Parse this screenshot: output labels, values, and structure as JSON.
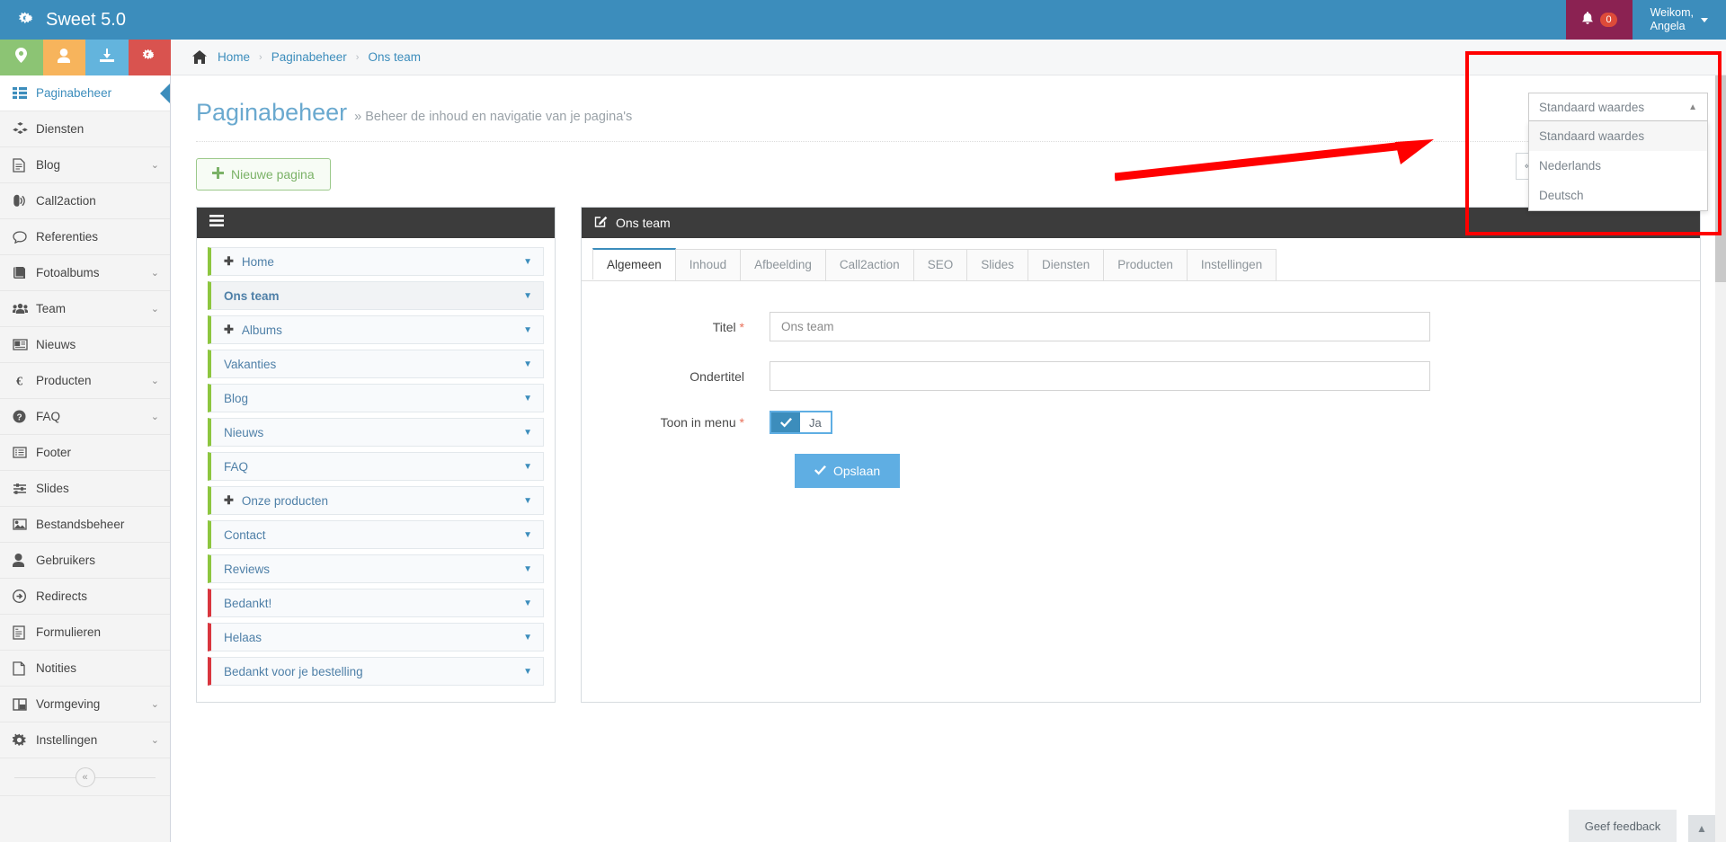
{
  "topbar": {
    "brand": "Sweet 5.0",
    "brand_icon": "gears-icon",
    "notification_count": "0",
    "user_greeting": "Weikom,",
    "user_name": "Angela"
  },
  "quick_actions": [
    {
      "name": "location-icon",
      "color": "#8cc474"
    },
    {
      "name": "user-icon",
      "color": "#f7b45c"
    },
    {
      "name": "download-icon",
      "color": "#63b4dd"
    },
    {
      "name": "gears-icon",
      "color": "#d9534f"
    }
  ],
  "breadcrumb": {
    "home_icon": "home-icon",
    "items": [
      "Home",
      "Paginabeheer",
      "Ons team"
    ]
  },
  "sidebar": {
    "items": [
      {
        "label": "Paginabeheer",
        "icon": "list-icon",
        "active": true,
        "caret": false
      },
      {
        "label": "Diensten",
        "icon": "cubes-icon",
        "active": false,
        "caret": false
      },
      {
        "label": "Blog",
        "icon": "document-icon",
        "active": false,
        "caret": true
      },
      {
        "label": "Call2action",
        "icon": "bullhorn-icon",
        "active": false,
        "caret": false
      },
      {
        "label": "Referenties",
        "icon": "comment-icon",
        "active": false,
        "caret": false
      },
      {
        "label": "Fotoalbums",
        "icon": "book-icon",
        "active": false,
        "caret": true
      },
      {
        "label": "Team",
        "icon": "users-icon",
        "active": false,
        "caret": true
      },
      {
        "label": "Nieuws",
        "icon": "newspaper-icon",
        "active": false,
        "caret": false
      },
      {
        "label": "Producten",
        "icon": "euro-icon",
        "active": false,
        "caret": true
      },
      {
        "label": "FAQ",
        "icon": "question-circle-icon",
        "active": false,
        "caret": true
      },
      {
        "label": "Footer",
        "icon": "list-alt-icon",
        "active": false,
        "caret": false
      },
      {
        "label": "Slides",
        "icon": "sliders-icon",
        "active": false,
        "caret": false
      },
      {
        "label": "Bestandsbeheer",
        "icon": "image-icon",
        "active": false,
        "caret": false
      },
      {
        "label": "Gebruikers",
        "icon": "user-icon",
        "active": false,
        "caret": false
      },
      {
        "label": "Redirects",
        "icon": "arrow-circle-right-icon",
        "active": false,
        "caret": false
      },
      {
        "label": "Formulieren",
        "icon": "form-icon",
        "active": false,
        "caret": false
      },
      {
        "label": "Notities",
        "icon": "note-icon",
        "active": false,
        "caret": false
      },
      {
        "label": "Vormgeving",
        "icon": "layout-icon",
        "active": false,
        "caret": true
      },
      {
        "label": "Instellingen",
        "icon": "gear-icon",
        "active": false,
        "caret": true
      }
    ],
    "collapse_icon": "double-chevron-left-icon"
  },
  "page": {
    "title": "Paginabeheer",
    "subtitle": "» Beheer de inhoud en navigatie van je pagina's",
    "new_page_button": "Nieuwe pagina",
    "new_page_icon": "plus-icon"
  },
  "tree": {
    "menu_icon": "hamburger-icon",
    "items": [
      {
        "label": "Home",
        "expandable": true,
        "accent": "#8dc63f",
        "selected": false
      },
      {
        "label": "Ons team",
        "expandable": false,
        "accent": "#8dc63f",
        "selected": true
      },
      {
        "label": "Albums",
        "expandable": true,
        "accent": "#8dc63f",
        "selected": false
      },
      {
        "label": "Vakanties",
        "expandable": false,
        "accent": "#8dc63f",
        "selected": false
      },
      {
        "label": "Blog",
        "expandable": false,
        "accent": "#8dc63f",
        "selected": false
      },
      {
        "label": "Nieuws",
        "expandable": false,
        "accent": "#8dc63f",
        "selected": false
      },
      {
        "label": "FAQ",
        "expandable": false,
        "accent": "#8dc63f",
        "selected": false
      },
      {
        "label": "Onze producten",
        "expandable": true,
        "accent": "#8dc63f",
        "selected": false
      },
      {
        "label": "Contact",
        "expandable": false,
        "accent": "#8dc63f",
        "selected": false
      },
      {
        "label": "Reviews",
        "expandable": false,
        "accent": "#8dc63f",
        "selected": false
      },
      {
        "label": "Bedankt!",
        "expandable": false,
        "accent": "#d9363e",
        "selected": false
      },
      {
        "label": "Helaas",
        "expandable": false,
        "accent": "#d9363e",
        "selected": false
      },
      {
        "label": "Bedankt voor je bestelling",
        "expandable": false,
        "accent": "#d9363e",
        "selected": false
      }
    ]
  },
  "editor": {
    "header_title": "Ons team",
    "header_icon": "edit-icon",
    "tabs": [
      {
        "label": "Algemeen",
        "active": true
      },
      {
        "label": "Inhoud",
        "active": false
      },
      {
        "label": "Afbeelding",
        "active": false
      },
      {
        "label": "Call2action",
        "active": false
      },
      {
        "label": "SEO",
        "active": false
      },
      {
        "label": "Slides",
        "active": false
      },
      {
        "label": "Diensten",
        "active": false
      },
      {
        "label": "Producten",
        "active": false
      },
      {
        "label": "Instellingen",
        "active": false
      }
    ],
    "fields": {
      "title_label": "Titel",
      "title_value": "Ons team",
      "title_required": "*",
      "subtitle_label": "Ondertitel",
      "subtitle_value": "",
      "menu_label": "Toon in menu",
      "menu_required": "*",
      "menu_toggle_value": "Ja",
      "toggle_check_icon": "check-icon"
    },
    "save_button": "Opslaan",
    "save_icon": "check-icon"
  },
  "language_dropdown": {
    "selected": "Standaard waardes",
    "caret_icon": "chevron-up-icon",
    "options": [
      {
        "label": "Standaard waardes",
        "highlighted": true
      },
      {
        "label": "Nederlands",
        "highlighted": false
      },
      {
        "label": "Deutsch",
        "highlighted": false
      }
    ]
  },
  "collapse_widget": {
    "icon": "double-chevron-left-icon"
  },
  "footer": {
    "feedback_label": "Geef feedback",
    "to_top_icon": "chevron-up-icon"
  },
  "annotation": {
    "box_color": "#ff0000",
    "arrow_color": "#ff0000"
  }
}
